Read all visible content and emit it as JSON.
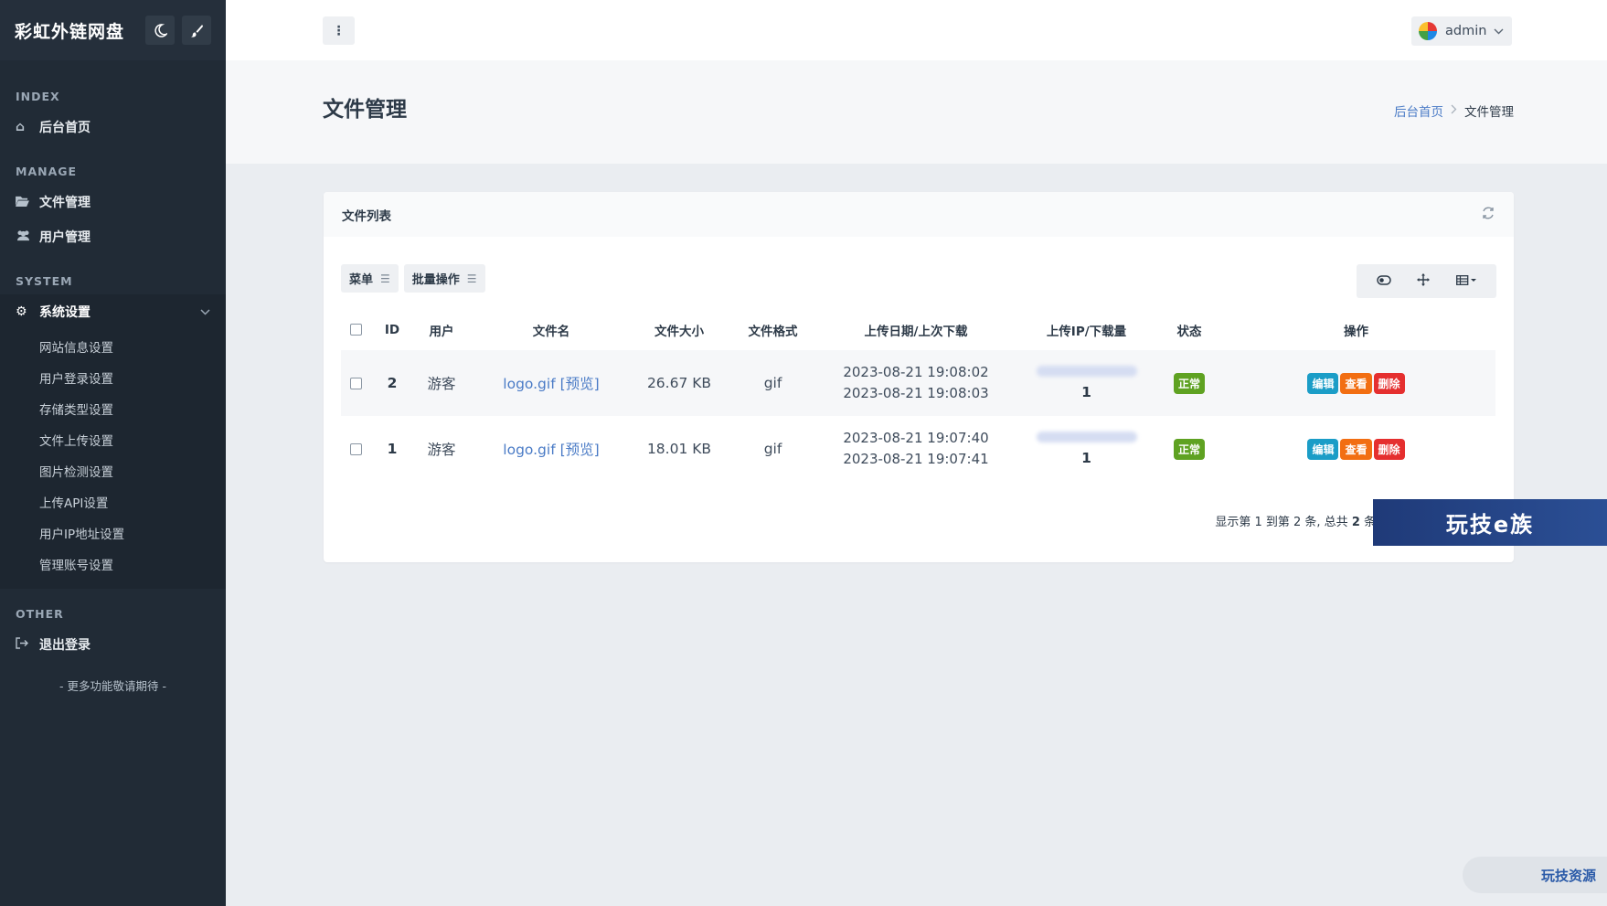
{
  "brand": {
    "title": "彩虹外链网盘"
  },
  "sidebar": {
    "sections": [
      {
        "heading": "INDEX"
      },
      {
        "heading": "MANAGE"
      },
      {
        "heading": "SYSTEM"
      },
      {
        "heading": "OTHER"
      }
    ],
    "items": [
      {
        "label": "后台首页",
        "icon": "home-icon"
      },
      {
        "label": "文件管理",
        "icon": "folder-open-icon"
      },
      {
        "label": "用户管理",
        "icon": "users-icon"
      },
      {
        "label": "系统设置",
        "icon": "gear-icon"
      },
      {
        "label": "退出登录",
        "icon": "logout-icon"
      }
    ],
    "sub_items": [
      "网站信息设置",
      "用户登录设置",
      "存储类型设置",
      "文件上传设置",
      "图片检测设置",
      "上传API设置",
      "用户IP地址设置",
      "管理账号设置"
    ],
    "footer": "- 更多功能敬请期待 -"
  },
  "header": {
    "username": "admin"
  },
  "page": {
    "title": "文件管理",
    "breadcrumb": {
      "home": "后台首页",
      "current": "文件管理"
    }
  },
  "card": {
    "title": "文件列表",
    "toolbar": {
      "menu": "菜单",
      "batch": "批量操作"
    },
    "columns": [
      "ID",
      "用户",
      "文件名",
      "文件大小",
      "文件格式",
      "上传日期/上次下载",
      "上传IP/下载量",
      "状态",
      "操作"
    ],
    "rows": [
      {
        "id": "2",
        "user": "游客",
        "file": "logo.gif",
        "preview": "[预览]",
        "size": "26.67 KB",
        "format": "gif",
        "upload_date": "2023-08-21 19:08:02",
        "last_download": "2023-08-21 19:08:03",
        "downloads": "1",
        "status": "正常"
      },
      {
        "id": "1",
        "user": "游客",
        "file": "logo.gif",
        "preview": "[预览]",
        "size": "18.01 KB",
        "format": "gif",
        "upload_date": "2023-08-21 19:07:40",
        "last_download": "2023-08-21 19:07:41",
        "downloads": "1",
        "status": "正常"
      }
    ],
    "actions": {
      "edit": "编辑",
      "view": "查看",
      "delete": "删除"
    },
    "pager": {
      "prefix": "显示第 1 到第 2 条, 总共 ",
      "total": "2",
      "suffix": " 条"
    }
  },
  "watermarks": {
    "banner": "玩技e族",
    "pill": "玩技资源"
  },
  "colors": {
    "sidebar": "#212b36",
    "link": "#4a7bc6",
    "status_ok": "#5fa222",
    "edit": "#1b9dc7",
    "view": "#f26e12",
    "delete": "#e52f2f"
  }
}
